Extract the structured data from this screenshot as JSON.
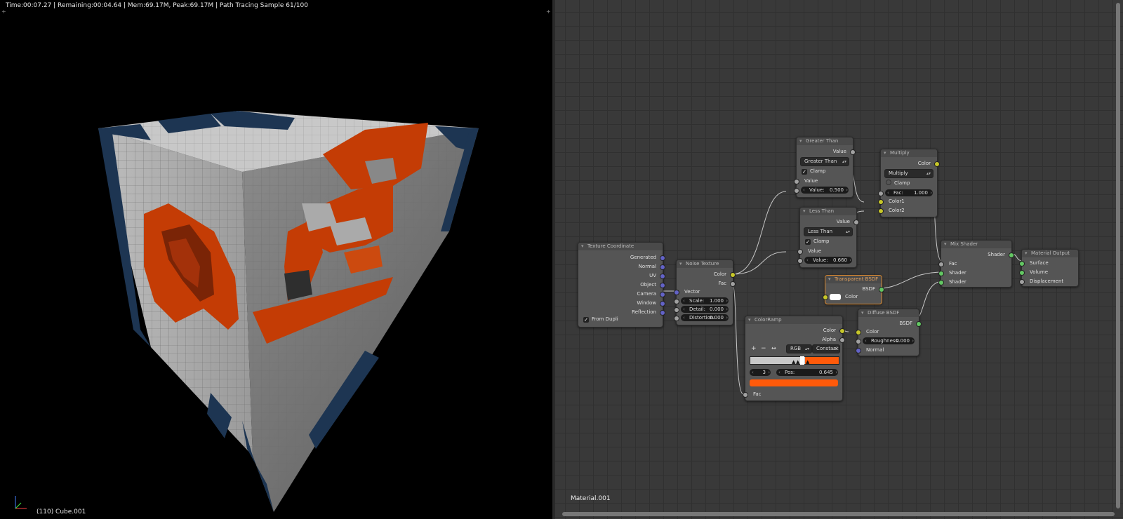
{
  "viewport": {
    "render_info": "Time:00:07.27 | Remaining:00:04.64 | Mem:69.17M, Peak:69.17M | Path Tracing Sample 61/100",
    "object_info": "(110) Cube.001"
  },
  "node_editor": {
    "material_name": "Material.001",
    "nodes": {
      "texture_coordinate": {
        "title": "Texture Coordinate",
        "outputs": [
          "Generated",
          "Normal",
          "UV",
          "Object",
          "Camera",
          "Window",
          "Reflection"
        ],
        "from_dupli": "From Dupli"
      },
      "noise_texture": {
        "title": "Noise Texture",
        "out_color": "Color",
        "out_fac": "Fac",
        "in_vector": "Vector",
        "scale_label": "Scale:",
        "scale_value": "1.000",
        "detail_label": "Detail:",
        "detail_value": "0.000",
        "distortion_label": "Distortion:",
        "distortion_value": "0.000"
      },
      "greater_than": {
        "title": "Greater Than",
        "out_value": "Value",
        "operation": "Greater Than",
        "clamp": "Clamp",
        "in_value": "Value",
        "value_label": "Value:",
        "value_value": "0.500"
      },
      "less_than": {
        "title": "Less Than",
        "out_value": "Value",
        "operation": "Less Than",
        "clamp": "Clamp",
        "in_value": "Value",
        "value_label": "Value:",
        "value_value": "0.660"
      },
      "multiply": {
        "title": "Multiply",
        "out_color": "Color",
        "blend": "Multiply",
        "clamp": "Clamp",
        "fac_label": "Fac:",
        "fac_value": "1.000",
        "in_color1": "Color1",
        "in_color2": "Color2"
      },
      "transparent_bsdf": {
        "title": "Transparent BSDF",
        "out_bsdf": "BSDF",
        "in_color": "Color",
        "swatch_color": "#ffffff"
      },
      "color_ramp": {
        "title": "ColorRamp",
        "out_color": "Color",
        "out_alpha": "Alpha",
        "btn_add": "+",
        "btn_remove": "−",
        "btn_flip": "↔",
        "color_mode": "RGB",
        "interpolation": "Constant",
        "active_index": "3",
        "pos_label": "Pos:",
        "pos_value": "0.645",
        "active_color": "#ff5a0a",
        "in_fac": "Fac"
      },
      "diffuse_bsdf": {
        "title": "Diffuse BSDF",
        "out_bsdf": "BSDF",
        "in_color": "Color",
        "roughness_label": "Roughness:",
        "roughness_value": "0.000",
        "in_normal": "Normal"
      },
      "mix_shader": {
        "title": "Mix Shader",
        "out_shader": "Shader",
        "in_fac": "Fac",
        "in_shader1": "Shader",
        "in_shader2": "Shader"
      },
      "material_output": {
        "title": "Material Output",
        "in_surface": "Surface",
        "in_volume": "Volume",
        "in_displacement": "Displacement"
      }
    }
  },
  "colors": {
    "orange": "#c43c05",
    "navy": "#1d3552",
    "white_voxel": "#cfcfcf",
    "socket_yellow": "#c7c729",
    "socket_grey": "#a1a1a1",
    "socket_green": "#63c763",
    "socket_blue": "#6363c7"
  }
}
